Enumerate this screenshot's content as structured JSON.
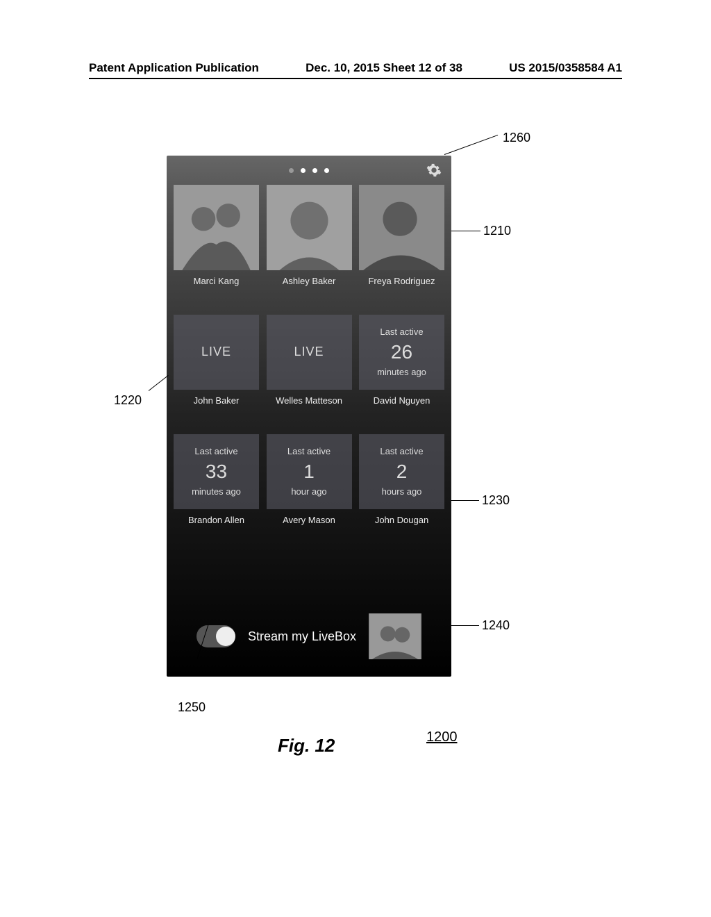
{
  "header": {
    "left": "Patent Application Publication",
    "center": "Dec. 10, 2015  Sheet 12 of 38",
    "right": "US 2015/0358584 A1"
  },
  "annotations": {
    "a1260": "1260",
    "a1210": "1210",
    "a1220": "1220",
    "a1230": "1230",
    "a1240": "1240",
    "a1250": "1250",
    "fig": "Fig. 12",
    "ref": "1200"
  },
  "phone": {
    "footer_label": "Stream my LiveBox",
    "row1": [
      {
        "name": "Marci Kang"
      },
      {
        "name": "Ashley Baker"
      },
      {
        "name": "Freya Rodriguez"
      }
    ],
    "row2": [
      {
        "top": "",
        "big": "LIVE",
        "bottom": "",
        "name": "John Baker"
      },
      {
        "top": "",
        "big": "LIVE",
        "bottom": "",
        "name": "Welles Matteson"
      },
      {
        "top": "Last active",
        "big": "26",
        "bottom": "minutes ago",
        "name": "David Nguyen"
      }
    ],
    "row3": [
      {
        "top": "Last active",
        "big": "33",
        "bottom": "minutes ago",
        "name": "Brandon Allen"
      },
      {
        "top": "Last active",
        "big": "1",
        "bottom": "hour ago",
        "name": "Avery Mason"
      },
      {
        "top": "Last active",
        "big": "2",
        "bottom": "hours ago",
        "name": "John Dougan"
      }
    ]
  }
}
